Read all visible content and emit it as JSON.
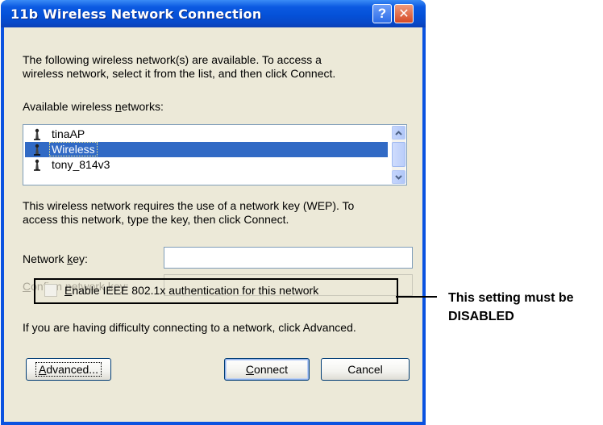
{
  "window": {
    "title": "11b Wireless Network Connection",
    "help_glyph": "?",
    "close_glyph": "✕"
  },
  "intro": {
    "line1": "The following wireless network(s) are available. To access a",
    "line2": "wireless network, select it from the list, and then click Connect."
  },
  "networks": {
    "label_pre": "Available wireless ",
    "label_key": "n",
    "label_post": "etworks:",
    "items": [
      {
        "label": "tinaAP",
        "selected": false
      },
      {
        "label": "Wireless",
        "selected": true
      },
      {
        "label": "tony_814v3",
        "selected": false
      }
    ]
  },
  "wep_notice": {
    "line1": "This wireless network requires the use of a network key (WEP). To",
    "line2": "access this network, type the key, then click Connect."
  },
  "network_key": {
    "label_pre": "Network ",
    "label_key": "k",
    "label_post": "ey:",
    "value": ""
  },
  "confirm_key": {
    "label_pre": "",
    "label_key": "C",
    "label_post": "onfirm network key:",
    "value": ""
  },
  "ieee_checkbox": {
    "label_key": "E",
    "label_post": "nable IEEE 802.1x authentication for this network",
    "checked": false
  },
  "help_text": "If you are having difficulty connecting to a network, click Advanced.",
  "buttons": {
    "advanced_key": "A",
    "advanced_post": "dvanced...",
    "connect_key": "C",
    "connect_post": "onnect",
    "cancel": "Cancel"
  },
  "callout": {
    "line1": "This setting must be",
    "line2": "DISABLED"
  },
  "colors": {
    "titlebar": "#0451d8",
    "selection": "#316ac5",
    "dialog_face": "#ece9d8",
    "disabled_text": "#aca899"
  }
}
